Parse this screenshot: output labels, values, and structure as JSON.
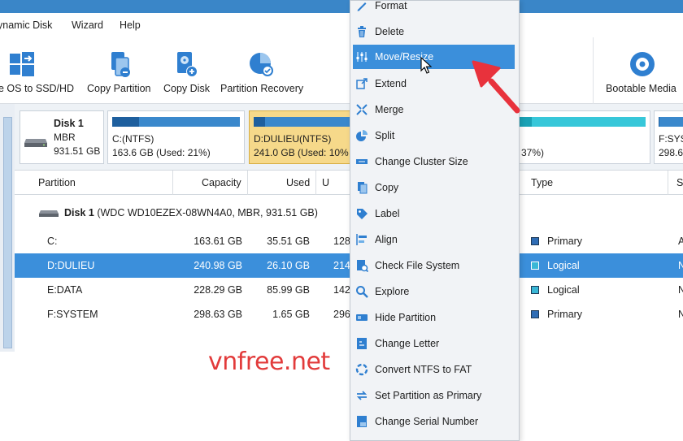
{
  "menubar": {
    "items": [
      "ynamic Disk",
      "Wizard",
      "Help"
    ]
  },
  "toolbar": {
    "items": [
      {
        "label": "e OS to SSD/HD",
        "icon": "windows-migrate-icon"
      },
      {
        "label": "Copy Partition",
        "icon": "copy-partition-icon"
      },
      {
        "label": "Copy Disk",
        "icon": "copy-disk-icon"
      },
      {
        "label": "Partition Recovery",
        "icon": "partition-recovery-icon"
      },
      {
        "label": "Bootable Media",
        "icon": "bootable-media-icon"
      }
    ]
  },
  "diskmap": {
    "disk": {
      "name": "Disk 1",
      "style": "MBR",
      "size": "931.51 GB"
    },
    "partitions": [
      {
        "name": "C:(NTFS)",
        "detail": "163.6 GB (Used: 21%)",
        "used": 0.21
      },
      {
        "name": "D:DULIEU(NTFS)",
        "detail": "241.0 GB (Used: 10%",
        "used": 0.1
      },
      {
        "detail": "3) 37%)",
        "used": 0.37
      },
      {
        "name": "F:SYS",
        "detail": "298.6",
        "used": 0.01
      }
    ]
  },
  "table": {
    "headers": {
      "partition": "Partition",
      "capacity": "Capacity",
      "used": "Used",
      "unused": "U",
      "type": "Type",
      "status": "S"
    },
    "disk_row": {
      "name": "Disk 1",
      "detail": "(WDC WD10EZEX-08WN4A0, MBR, 931.51 GB)"
    },
    "rows": [
      {
        "partition": "C:",
        "capacity": "163.61 GB",
        "used": "35.51 GB",
        "unused": "128",
        "type": "Primary",
        "status": "A"
      },
      {
        "partition": "D:DULIEU",
        "capacity": "240.98 GB",
        "used": "26.10 GB",
        "unused": "214",
        "type": "Logical",
        "status": "N"
      },
      {
        "partition": "E:DATA",
        "capacity": "228.29 GB",
        "used": "85.99 GB",
        "unused": "142",
        "type": "Logical",
        "status": "N"
      },
      {
        "partition": "F:SYSTEM",
        "capacity": "298.63 GB",
        "used": "1.65 GB",
        "unused": "296",
        "type": "Primary",
        "status": "N"
      }
    ]
  },
  "watermark": "vnfree.net",
  "context_menu": {
    "items": [
      {
        "label": "Format",
        "icon": "pen-icon"
      },
      {
        "label": "Delete",
        "icon": "trash-icon"
      },
      {
        "label": "Move/Resize",
        "icon": "resize-sliders-icon",
        "highlighted": true
      },
      {
        "label": "Extend",
        "icon": "extend-icon"
      },
      {
        "label": "Merge",
        "icon": "merge-icon"
      },
      {
        "label": "Split",
        "icon": "split-pie-icon"
      },
      {
        "label": "Change Cluster Size",
        "icon": "cluster-size-icon"
      },
      {
        "label": "Copy",
        "icon": "copy-icon"
      },
      {
        "label": "Label",
        "icon": "tag-icon"
      },
      {
        "label": "Align",
        "icon": "align-icon"
      },
      {
        "label": "Check File System",
        "icon": "check-file-system-icon"
      },
      {
        "label": "Explore",
        "icon": "explore-icon"
      },
      {
        "label": "Hide Partition",
        "icon": "hide-partition-icon"
      },
      {
        "label": "Change Letter",
        "icon": "change-letter-icon"
      },
      {
        "label": "Convert NTFS to FAT",
        "icon": "convert-icon"
      },
      {
        "label": "Set Partition as Primary",
        "icon": "set-primary-icon"
      },
      {
        "label": "Change Serial Number",
        "icon": "serial-number-icon"
      }
    ]
  },
  "colors": {
    "accent": "#3b8fdb",
    "selected_partition": "#f6d98a",
    "bar_blue": "#3a88cc",
    "bar_cyan": "#37c7d9",
    "arrow_red": "#e8323c",
    "type_primary": "#2f6db5",
    "type_logical": "#3ab7d6"
  }
}
